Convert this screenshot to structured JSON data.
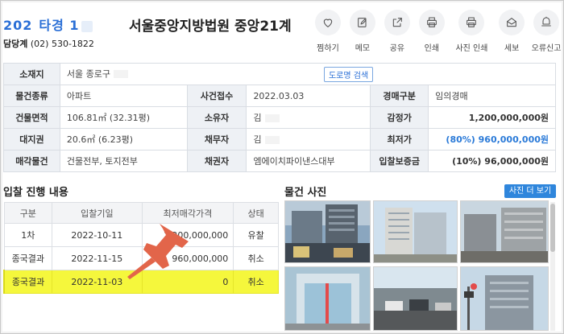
{
  "header": {
    "case_prefix": "202",
    "case_suffix": "타경 1",
    "court": "서울중앙지방법원 중앙21계",
    "contact_label": "담당계",
    "contact_phone": "(02) 530-1822"
  },
  "actions": [
    {
      "label": "찜하기",
      "icon": "heart-icon"
    },
    {
      "label": "메모",
      "icon": "edit-icon"
    },
    {
      "label": "공유",
      "icon": "share-icon"
    },
    {
      "label": "인쇄",
      "icon": "printer-icon"
    },
    {
      "label": "사진 인쇄",
      "icon": "printer-icon"
    },
    {
      "label": "세보",
      "icon": "mail-icon"
    },
    {
      "label": "오류신고",
      "icon": "alert-icon"
    }
  ],
  "info": {
    "location_label": "소재지",
    "location_value": "서울 종로구",
    "road_search": "도로명 검색",
    "type_label": "물건종류",
    "type_value": "아파트",
    "filed_label": "사건접수",
    "filed_value": "2022.03.03",
    "auction_type_label": "경매구분",
    "auction_type_value": "임의경매",
    "area_label": "건물면적",
    "area_value": "106.81㎡ (32.31평)",
    "owner_label": "소유자",
    "owner_value": "김",
    "appraisal_label": "감정가",
    "appraisal_value": "1,200,000,000원",
    "land_label": "대지권",
    "land_value": "20.6㎡ (6.23평)",
    "debtor_label": "채무자",
    "debtor_value": "김",
    "minimum_label": "최저가",
    "minimum_value": "(80%) 960,000,000원",
    "sale_label": "매각물건",
    "sale_value": "건물전부, 토지전부",
    "creditor_label": "채권자",
    "creditor_value": "엠에이치파이낸스대부",
    "deposit_label": "입찰보증금",
    "deposit_value": "(10%) 96,000,000원"
  },
  "bids": {
    "title": "입찰 진행 내용",
    "columns": [
      "구분",
      "입찰기일",
      "최저매각가격",
      "상태"
    ],
    "rows": [
      {
        "round": "1차",
        "date": "2022-10-11",
        "price": "1,200,000,000",
        "status": "유찰"
      },
      {
        "round": "종국결과",
        "date": "2022-11-15",
        "price": "960,000,000",
        "status": "취소"
      },
      {
        "round": "종국결과",
        "date": "2022-11-03",
        "price": "0",
        "status": "취소"
      }
    ]
  },
  "photos": {
    "title": "물건 사진",
    "more": "사진 더 보기"
  },
  "colors": {
    "accent": "#2a6fd6",
    "highlight": "#f5f73c",
    "pin": "#e2654a",
    "button": "#2f86dc"
  }
}
